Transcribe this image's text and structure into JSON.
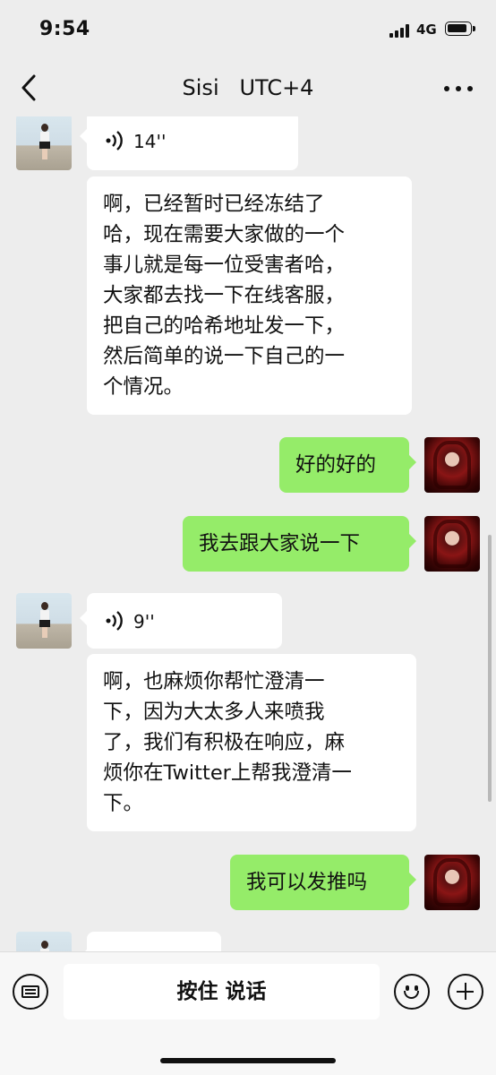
{
  "status": {
    "time": "9:54",
    "network": "4G"
  },
  "header": {
    "title": "Sisi   UTC+4"
  },
  "messages": [
    {
      "id": "m1",
      "side": "left",
      "type": "voice",
      "duration": "14''"
    },
    {
      "id": "m2",
      "side": "left",
      "type": "text",
      "text": "啊，已经暂时已经冻结了\n哈，现在需要大家做的一个\n事儿就是每一位受害者哈，\n大家都去找一下在线客服，\n把自己的哈希地址发一下，\n然后简单的说一下自己的一\n个情况。"
    },
    {
      "id": "m3",
      "side": "right",
      "type": "text",
      "text": "好的好的"
    },
    {
      "id": "m4",
      "side": "right",
      "type": "text",
      "text": "我去跟大家说一下"
    },
    {
      "id": "m5",
      "side": "left",
      "type": "voice",
      "duration": "9''"
    },
    {
      "id": "m6",
      "side": "left",
      "type": "text",
      "text": "啊，也麻烦你帮忙澄清一\n下，因为大太多人来喷我\n了，我们有积极在响应，麻\n烦你在Twitter上帮我澄清一\n下。"
    },
    {
      "id": "m7",
      "side": "right",
      "type": "text",
      "text": "我可以发推吗"
    }
  ],
  "input_bar": {
    "hold_to_talk": "按住 说话"
  }
}
